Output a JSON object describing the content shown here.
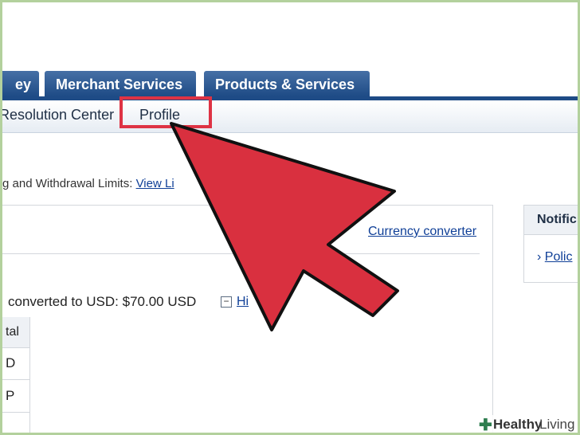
{
  "nav": {
    "tabs": [
      {
        "label": "ey"
      },
      {
        "label": "Merchant Services"
      },
      {
        "label": "Products & Services"
      }
    ],
    "subnav": [
      {
        "label": "Resolution Center"
      },
      {
        "label": "Profile"
      }
    ]
  },
  "limits": {
    "text": "g and Withdrawal Limits: ",
    "link": "View Li"
  },
  "balance": {
    "currency_link": "Currency converter",
    "converted_text": "converted to USD: $70.00 USD",
    "hide_toggle": "−",
    "hide_label": "Hi",
    "table": {
      "header": "tal",
      "rows": [
        "D",
        "P"
      ]
    }
  },
  "notifications": {
    "title": "Notific",
    "bullet": "›",
    "link": "Polic"
  },
  "watermark": {
    "word1": "Healthy",
    "word2": "Living"
  },
  "colors": {
    "highlight": "#de3344",
    "arrow": "#d9303f",
    "tab": "#1e4b86",
    "link": "#0f3f97"
  }
}
